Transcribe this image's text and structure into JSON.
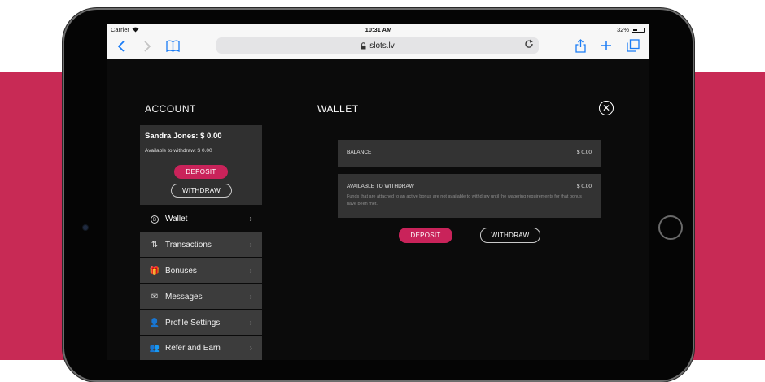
{
  "status_bar": {
    "carrier": "Carrier",
    "time": "10:31 AM",
    "battery": "32%"
  },
  "browser": {
    "url": "slots.lv",
    "back_icon": "chevron-left-icon",
    "forward_icon": "chevron-right-icon",
    "bookmarks_icon": "book-icon",
    "reload_icon": "reload-icon",
    "share_icon": "share-icon",
    "new_tab_icon": "plus-icon",
    "tabs_icon": "tabs-icon"
  },
  "account": {
    "title": "ACCOUNT",
    "user_name": "Sandra Jones: $ 0.00",
    "available_to_withdraw": "Available to withdraw: $ 0.00",
    "deposit_label": "DEPOSIT",
    "withdraw_label": "WITHDRAW"
  },
  "menu": [
    {
      "label": "Wallet",
      "icon": "coin-icon",
      "glyph": "B"
    },
    {
      "label": "Transactions",
      "icon": "transactions-icon",
      "glyph": "⇅"
    },
    {
      "label": "Bonuses",
      "icon": "gift-icon",
      "glyph": "🎁"
    },
    {
      "label": "Messages",
      "icon": "envelope-icon",
      "glyph": "✉"
    },
    {
      "label": "Profile Settings",
      "icon": "user-settings-icon",
      "glyph": "👤"
    },
    {
      "label": "Refer and Earn",
      "icon": "users-icon",
      "glyph": "👥"
    }
  ],
  "wallet": {
    "title": "WALLET",
    "balance_label": "BALANCE",
    "balance_value": "$ 0.00",
    "available_label": "AVAILABLE TO WITHDRAW",
    "available_value": "$ 0.00",
    "available_note": "Funds that are attached to an active bonus are not available to withdraw until the wagering requirements for that bonus have been met.",
    "deposit_label": "DEPOSIT",
    "withdraw_label": "WITHDRAW"
  },
  "colors": {
    "brand_pink": "#c82a55",
    "deposit_button": "#c9235a"
  }
}
